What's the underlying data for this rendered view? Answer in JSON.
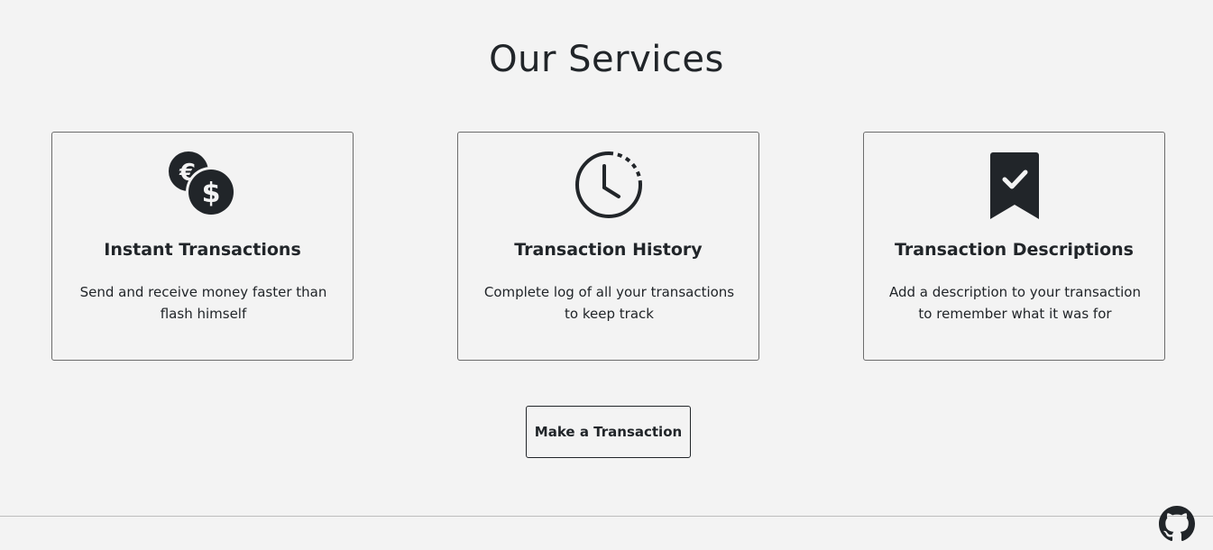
{
  "section": {
    "title": "Our Services"
  },
  "cards": [
    {
      "icon": "currency-coins-icon",
      "title": "Instant Transactions",
      "text": "Send and receive money faster than flash himself"
    },
    {
      "icon": "clock-history-icon",
      "title": "Transaction History",
      "text": "Complete log of all your transactions to keep track"
    },
    {
      "icon": "bookmark-check-icon",
      "title": "Transaction Descriptions",
      "text": "Add a description to your transaction to remember what it was for"
    }
  ],
  "cta": {
    "label": "Make a Transaction"
  },
  "footer": {
    "github_icon": "github-icon"
  },
  "colors": {
    "background": "#f3f3f3",
    "text": "#212529",
    "border": "#6c6c6c"
  }
}
